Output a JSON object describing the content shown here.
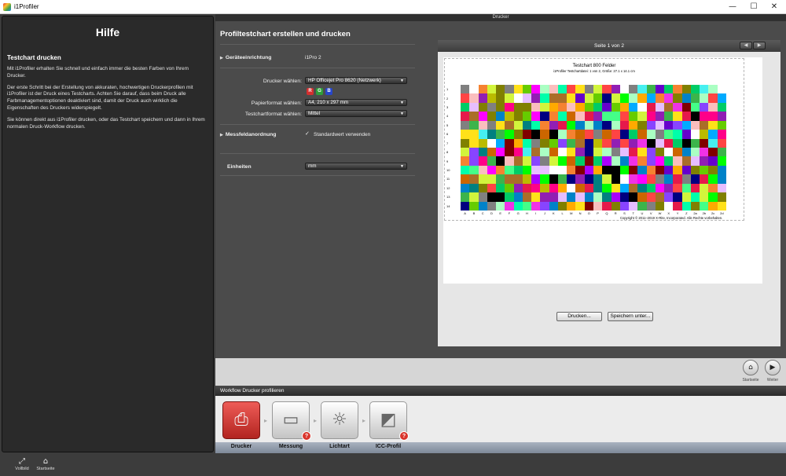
{
  "window": {
    "title": "i1Profiler",
    "minimize": "—",
    "maximize": "☐",
    "close": "✕"
  },
  "help": {
    "heading": "Hilfe",
    "subheading": "Testchart drucken",
    "paragraphs": [
      "Mit i1Profiler erhalten Sie schnell und einfach immer die besten Farben von Ihrem Drucker.",
      "Der erste Schritt bei der Erstellung von akkuraten, hochwertigen Druckerprofilen mit i1Profiler ist der Druck eines Testcharts. Achten Sie darauf, dass beim Druck alle Farbmanagementoptionen deaktiviert sind, damit der Druck auch wirklich die Eigenschaften des Druckers widerspiegelt.",
      "Sie können direkt aus i1Profiler drucken, oder das Testchart speichern und dann in Ihrem normalen Druck-Workflow drucken."
    ]
  },
  "main": {
    "header": "Drucker",
    "section_title": "Profiltestchart erstellen und drucken",
    "device_label": "Geräteeinrichtung",
    "device_value": "i1Pro 2",
    "printer_label": "Drucker wählen:",
    "printer_value": "HP Officejet Pro 8620 (Netzwerk)",
    "paper_label": "Papierformat wählen:",
    "paper_value": "A4, 210 x 297 mm",
    "chart_format_label": "Testchartformat wählen:",
    "chart_format_value": "Mittel",
    "patch_layout_label": "Messfeldanordnung",
    "default_checkbox_label": "Standardwert verwenden",
    "units_label": "Einheiten",
    "units_value": "mm",
    "ink_icons": [
      {
        "letter": "R",
        "color": "#d32f2f"
      },
      {
        "letter": "G",
        "color": "#2e9e3a"
      },
      {
        "letter": "B",
        "color": "#2746c9"
      }
    ]
  },
  "preview": {
    "page_indicator": "Seite 1 von 2",
    "prev": "◀",
    "next": "▶",
    "chart_title": "Testchart 800 Felder",
    "chart_subtitle": "i1Profiler Testchartdatei: 1 von 2, Größe: 27.1 x 14.1 cm",
    "copyright": "Copyright © 2011–2019 X-Rite, Incorporated. Alle Rechte vorbehalten.",
    "rows": 14,
    "cols": 30,
    "print_button": "Drucken...",
    "save_button": "Speichern unter..."
  },
  "nav": {
    "home_label": "Startseite",
    "next_label": "Weiter",
    "home_icon": "⌂",
    "next_icon": "▶"
  },
  "workflow": {
    "bar_title": "Workflow Drucker profilieren",
    "steps": [
      {
        "label": "Drucker",
        "glyph": "⎙"
      },
      {
        "label": "Messung",
        "glyph": "▭"
      },
      {
        "label": "Lichtart",
        "glyph": "☼"
      },
      {
        "label": "ICC-Profil",
        "glyph": "◩"
      }
    ]
  },
  "bottombar": {
    "fullscreen_label": "Vollbild",
    "fullscreen_icon": "⤢",
    "home_label": "Startseite",
    "home_icon": "⌂"
  }
}
